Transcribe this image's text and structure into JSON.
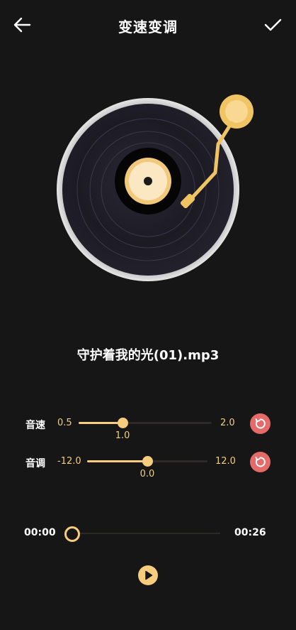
{
  "header": {
    "title": "变速变调"
  },
  "song": {
    "title": "守护着我的光(01).mp3"
  },
  "speed": {
    "label": "音速",
    "min": "0.5",
    "max": "2.0",
    "value": "1.0",
    "fraction": 0.33
  },
  "pitch": {
    "label": "音调",
    "min": "-12.0",
    "max": "12.0",
    "value": "0.0",
    "fraction": 0.5
  },
  "player": {
    "current_time": "00:00",
    "total_time": "00:26",
    "progress": 0
  },
  "colors": {
    "accent": "#f5cd7c",
    "reset": "#e56a6a",
    "background": "#161616"
  },
  "icons": {
    "back": "arrow-left-icon",
    "confirm": "check-icon",
    "reset": "reset-icon",
    "play": "play-icon"
  }
}
